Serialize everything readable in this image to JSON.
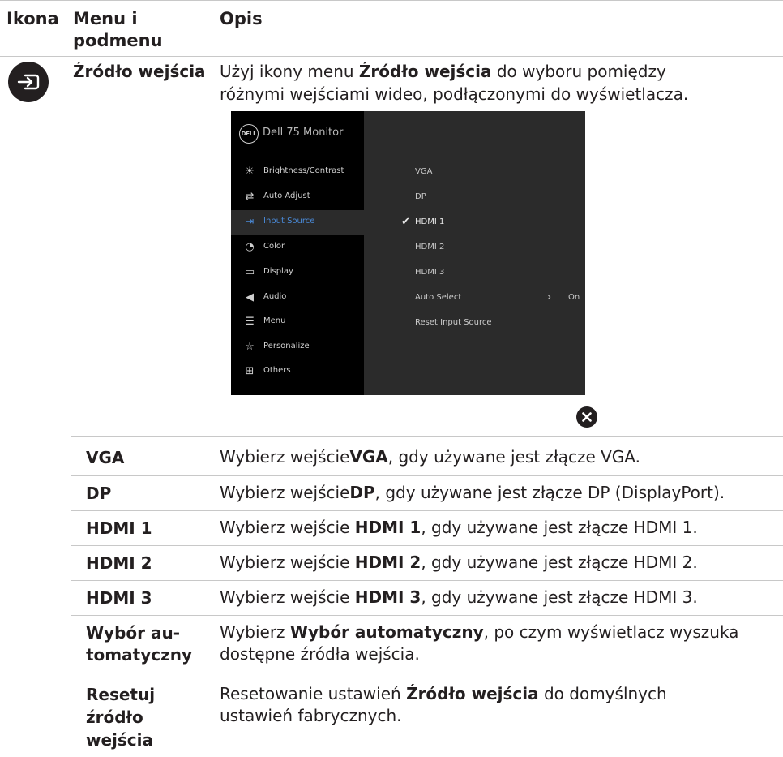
{
  "header": {
    "col_icon": "Ikona",
    "col_menu_line1": "Menu i",
    "col_menu_line2": "podmenu",
    "col_desc": "Opis"
  },
  "main_row": {
    "name": "Źródło wejścia",
    "desc_pre": "Użyj ikony menu ",
    "desc_bold": "Źródło wejścia",
    "desc_post": " do wyboru pomiędzy",
    "desc_line2": "różnymi wejściami wideo, podłączonymi do wyświetlacza."
  },
  "osd": {
    "logo": "DELL",
    "title": "Dell 75 Monitor",
    "menu": [
      {
        "label": "Brightness/Contrast",
        "icon": "brightness-icon"
      },
      {
        "label": "Auto Adjust",
        "icon": "auto-adjust-icon"
      },
      {
        "label": "Input Source",
        "icon": "input-source-icon"
      },
      {
        "label": "Color",
        "icon": "color-icon"
      },
      {
        "label": "Display",
        "icon": "display-icon"
      },
      {
        "label": "Audio",
        "icon": "audio-icon"
      },
      {
        "label": "Menu",
        "icon": "menu-icon"
      },
      {
        "label": "Personalize",
        "icon": "star-icon"
      },
      {
        "label": "Others",
        "icon": "others-icon"
      }
    ],
    "active_index": 2,
    "submenu": [
      "VGA",
      "DP",
      "HDMI 1",
      "HDMI 2",
      "HDMI 3",
      "Auto Select",
      "Reset Input Source"
    ],
    "selected": "HDMI 1",
    "auto_select_value": "On"
  },
  "rows": [
    {
      "name": "VGA",
      "pre": "Wybierz wejście",
      "bold": "VGA",
      "post": ", gdy używane jest złącze VGA."
    },
    {
      "name": "DP",
      "pre": "Wybierz wejście",
      "bold": "DP",
      "post": ", gdy używane jest złącze DP (DisplayPort)."
    },
    {
      "name": "HDMI 1",
      "pre": "Wybierz wejście ",
      "bold": "HDMI 1",
      "post": ", gdy używane jest złącze HDMI 1."
    },
    {
      "name": "HDMI 2",
      "pre": "Wybierz wejście ",
      "bold": "HDMI 2",
      "post": ", gdy używane jest złącze HDMI 2."
    },
    {
      "name": "HDMI 3",
      "pre": "Wybierz wejście ",
      "bold": "HDMI 3",
      "post": ", gdy używane jest złącze HDMI 3."
    },
    {
      "name_line1": "Wybór au-",
      "name_line2": "tomatyczny",
      "pre": "Wybierz ",
      "bold": "Wybór automatyczny",
      "post": ", po czym wyświetlacz wyszuka",
      "line2": "dostępne źródła wejścia."
    },
    {
      "name_line1": "Resetuj",
      "name_line2": "źródło",
      "name_line3": "wejścia",
      "pre": "Resetowanie ustawień ",
      "bold": "Źródło wejścia",
      "post": " do domyślnych",
      "line2": "ustawień fabrycznych."
    }
  ]
}
